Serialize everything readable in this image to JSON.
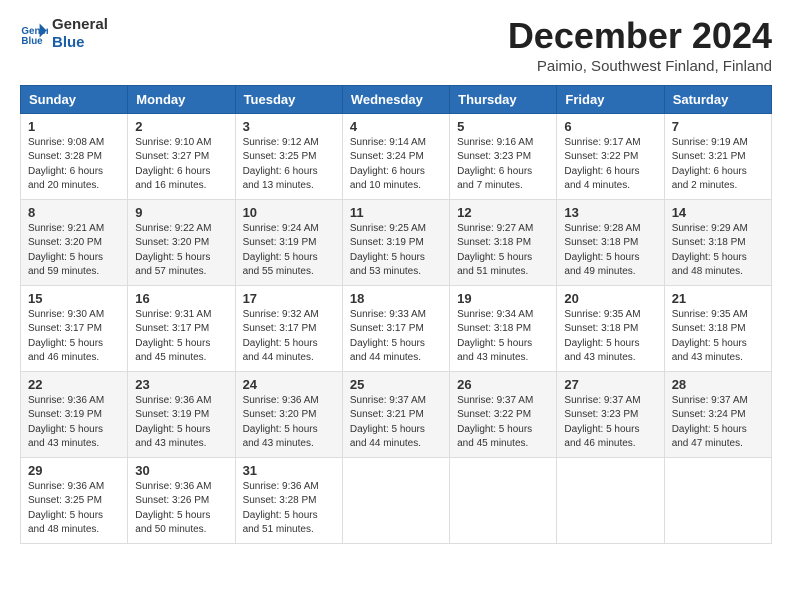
{
  "header": {
    "logo_line1": "General",
    "logo_line2": "Blue",
    "title": "December 2024",
    "subtitle": "Paimio, Southwest Finland, Finland"
  },
  "weekdays": [
    "Sunday",
    "Monday",
    "Tuesday",
    "Wednesday",
    "Thursday",
    "Friday",
    "Saturday"
  ],
  "weeks": [
    [
      {
        "day": "1",
        "sunrise": "9:08 AM",
        "sunset": "3:28 PM",
        "daylight": "6 hours and 20 minutes."
      },
      {
        "day": "2",
        "sunrise": "9:10 AM",
        "sunset": "3:27 PM",
        "daylight": "6 hours and 16 minutes."
      },
      {
        "day": "3",
        "sunrise": "9:12 AM",
        "sunset": "3:25 PM",
        "daylight": "6 hours and 13 minutes."
      },
      {
        "day": "4",
        "sunrise": "9:14 AM",
        "sunset": "3:24 PM",
        "daylight": "6 hours and 10 minutes."
      },
      {
        "day": "5",
        "sunrise": "9:16 AM",
        "sunset": "3:23 PM",
        "daylight": "6 hours and 7 minutes."
      },
      {
        "day": "6",
        "sunrise": "9:17 AM",
        "sunset": "3:22 PM",
        "daylight": "6 hours and 4 minutes."
      },
      {
        "day": "7",
        "sunrise": "9:19 AM",
        "sunset": "3:21 PM",
        "daylight": "6 hours and 2 minutes."
      }
    ],
    [
      {
        "day": "8",
        "sunrise": "9:21 AM",
        "sunset": "3:20 PM",
        "daylight": "5 hours and 59 minutes."
      },
      {
        "day": "9",
        "sunrise": "9:22 AM",
        "sunset": "3:20 PM",
        "daylight": "5 hours and 57 minutes."
      },
      {
        "day": "10",
        "sunrise": "9:24 AM",
        "sunset": "3:19 PM",
        "daylight": "5 hours and 55 minutes."
      },
      {
        "day": "11",
        "sunrise": "9:25 AM",
        "sunset": "3:19 PM",
        "daylight": "5 hours and 53 minutes."
      },
      {
        "day": "12",
        "sunrise": "9:27 AM",
        "sunset": "3:18 PM",
        "daylight": "5 hours and 51 minutes."
      },
      {
        "day": "13",
        "sunrise": "9:28 AM",
        "sunset": "3:18 PM",
        "daylight": "5 hours and 49 minutes."
      },
      {
        "day": "14",
        "sunrise": "9:29 AM",
        "sunset": "3:18 PM",
        "daylight": "5 hours and 48 minutes."
      }
    ],
    [
      {
        "day": "15",
        "sunrise": "9:30 AM",
        "sunset": "3:17 PM",
        "daylight": "5 hours and 46 minutes."
      },
      {
        "day": "16",
        "sunrise": "9:31 AM",
        "sunset": "3:17 PM",
        "daylight": "5 hours and 45 minutes."
      },
      {
        "day": "17",
        "sunrise": "9:32 AM",
        "sunset": "3:17 PM",
        "daylight": "5 hours and 44 minutes."
      },
      {
        "day": "18",
        "sunrise": "9:33 AM",
        "sunset": "3:17 PM",
        "daylight": "5 hours and 44 minutes."
      },
      {
        "day": "19",
        "sunrise": "9:34 AM",
        "sunset": "3:18 PM",
        "daylight": "5 hours and 43 minutes."
      },
      {
        "day": "20",
        "sunrise": "9:35 AM",
        "sunset": "3:18 PM",
        "daylight": "5 hours and 43 minutes."
      },
      {
        "day": "21",
        "sunrise": "9:35 AM",
        "sunset": "3:18 PM",
        "daylight": "5 hours and 43 minutes."
      }
    ],
    [
      {
        "day": "22",
        "sunrise": "9:36 AM",
        "sunset": "3:19 PM",
        "daylight": "5 hours and 43 minutes."
      },
      {
        "day": "23",
        "sunrise": "9:36 AM",
        "sunset": "3:19 PM",
        "daylight": "5 hours and 43 minutes."
      },
      {
        "day": "24",
        "sunrise": "9:36 AM",
        "sunset": "3:20 PM",
        "daylight": "5 hours and 43 minutes."
      },
      {
        "day": "25",
        "sunrise": "9:37 AM",
        "sunset": "3:21 PM",
        "daylight": "5 hours and 44 minutes."
      },
      {
        "day": "26",
        "sunrise": "9:37 AM",
        "sunset": "3:22 PM",
        "daylight": "5 hours and 45 minutes."
      },
      {
        "day": "27",
        "sunrise": "9:37 AM",
        "sunset": "3:23 PM",
        "daylight": "5 hours and 46 minutes."
      },
      {
        "day": "28",
        "sunrise": "9:37 AM",
        "sunset": "3:24 PM",
        "daylight": "5 hours and 47 minutes."
      }
    ],
    [
      {
        "day": "29",
        "sunrise": "9:36 AM",
        "sunset": "3:25 PM",
        "daylight": "5 hours and 48 minutes."
      },
      {
        "day": "30",
        "sunrise": "9:36 AM",
        "sunset": "3:26 PM",
        "daylight": "5 hours and 50 minutes."
      },
      {
        "day": "31",
        "sunrise": "9:36 AM",
        "sunset": "3:28 PM",
        "daylight": "5 hours and 51 minutes."
      },
      null,
      null,
      null,
      null
    ]
  ],
  "labels": {
    "sunrise": "Sunrise: ",
    "sunset": "Sunset: ",
    "daylight": "Daylight: "
  }
}
